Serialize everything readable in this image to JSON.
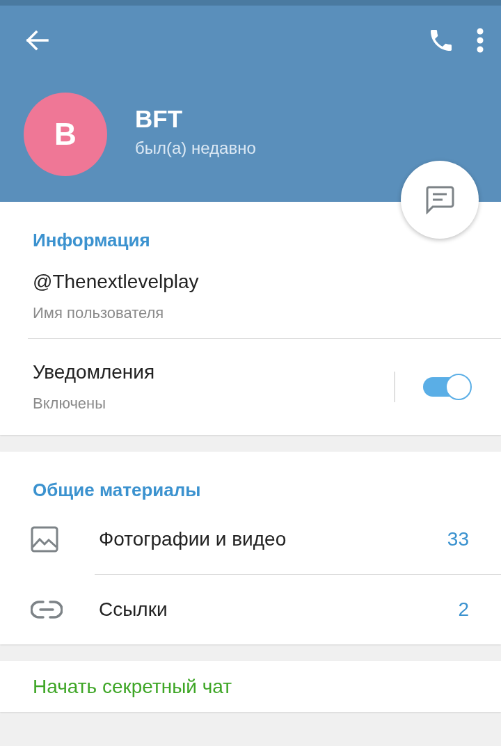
{
  "header": {
    "name": "BFT",
    "avatar_letter": "B",
    "status": "был(а) недавно"
  },
  "info": {
    "title": "Информация",
    "username": {
      "value": "@Thenextlevelplay",
      "label": "Имя пользователя"
    },
    "notifications": {
      "value": "Уведомления",
      "label": "Включены",
      "on": true
    }
  },
  "media": {
    "title": "Общие материалы",
    "items": [
      {
        "kind": "photos",
        "label": "Фотографии и видео",
        "count": "33"
      },
      {
        "kind": "links",
        "label": "Ссылки",
        "count": "2"
      }
    ]
  },
  "secret_chat": {
    "label": "Начать секретный чат"
  }
}
